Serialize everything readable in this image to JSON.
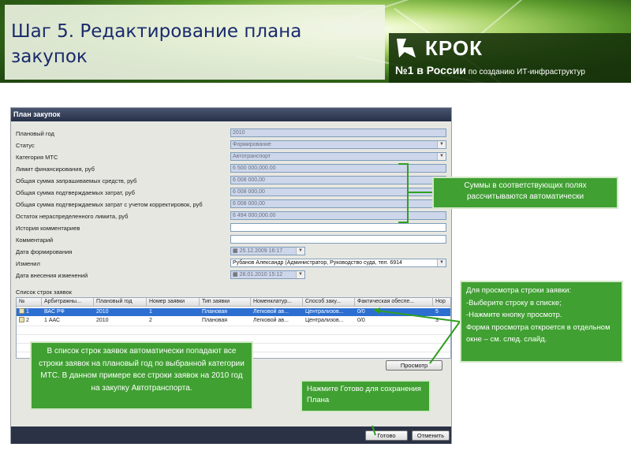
{
  "slide": {
    "title": "Шаг 5. Редактирование плана закупок",
    "logo": {
      "name": "КРОК",
      "tagline_big": "№1 в России",
      "tagline_small": "по созданию ИТ-инфраструктур"
    }
  },
  "window": {
    "title": "План закупок",
    "fields": [
      {
        "label": "Плановый год",
        "value": "2010",
        "kind": "readonly"
      },
      {
        "label": "Статус",
        "value": "Формирование",
        "kind": "readonly-select"
      },
      {
        "label": "Категория МТС",
        "value": "Автотранспорт",
        "kind": "readonly-select"
      },
      {
        "label": "Лимит финансирования, руб",
        "value": "6 500 000,000.00",
        "kind": "readonly"
      },
      {
        "label": "Общая сумма запрашиваемых средств, руб",
        "value": "6 008 000,00",
        "kind": "readonly"
      },
      {
        "label": "Общая сумма подтверждаемых затрат, руб",
        "value": "6 008 000,00",
        "kind": "readonly"
      },
      {
        "label": "Общая сумма подтверждаемых затрат с учетом корректировок, руб",
        "value": "6 008 000,00",
        "kind": "readonly"
      },
      {
        "label": "Остаток нераспределенного лимита, руб",
        "value": "6 494 000,000.00",
        "kind": "readonly"
      },
      {
        "label": "История комментариев",
        "value": "",
        "kind": "editable"
      },
      {
        "label": "Комментарий",
        "value": "",
        "kind": "editable"
      },
      {
        "label": "Дата формирования",
        "value": "25.12.2009 16:17",
        "kind": "date"
      },
      {
        "label": "Изменил",
        "value": "Рубанов Александр (Администратор, Руководство суда, тел. 6914",
        "kind": "select"
      },
      {
        "label": "Дата внесения изменений",
        "value": "28.01.2010 15:12",
        "kind": "date"
      }
    ],
    "list_label": "Список строк заявок",
    "table": {
      "columns": [
        "№",
        "Арбитражны...",
        "Плановый год",
        "Номер заявки",
        "Тип заявки",
        "Номенклатур...",
        "Способ заку...",
        "Фактическая обеспе...",
        "Нор"
      ],
      "rows": [
        [
          "1",
          "ВАС РФ",
          "2010",
          "1",
          "Плановая",
          "Легковой ав...",
          "Централизов...",
          "0/0",
          "5"
        ],
        [
          "2",
          "1 ААС",
          "2010",
          "2",
          "Плановая",
          "Легковой ав...",
          "Централизов...",
          "0/0",
          "3"
        ]
      ],
      "selected_row": 0
    },
    "buttons": {
      "view": "Просмотр",
      "done": "Готово",
      "cancel": "Отменить"
    }
  },
  "callouts": {
    "sums": "Суммы в соответствующих полях рассчитываются автоматически",
    "view": "Для просмотра строки заявки:\n-Выберите строку в списке;\n-Нажмите кнопку просмотр.\nФорма просмотра откроется в отдельном окне – см. след. слайд.",
    "list": "В список строк заявок автоматически попадают все строки заявок на плановый год по выбранной категории МТС. В данном примере все строки заявок на 2010 год на закупку Автотранспорта.",
    "done": "Нажмите Готово для сохранения Плана"
  },
  "colors": {
    "callout_green": "#40a032",
    "title_blue": "#1a2a6c",
    "selection_blue": "#2c6fd1",
    "readonly_field": "#cdd6ea"
  }
}
